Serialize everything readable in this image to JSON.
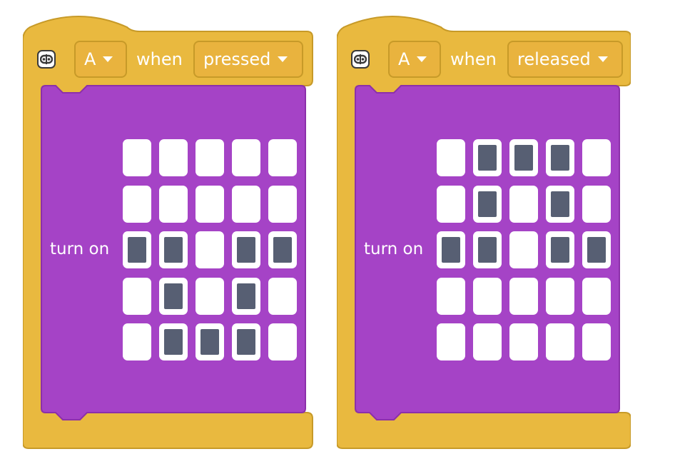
{
  "blocks": [
    {
      "button": "A",
      "when_label": "when",
      "event": "pressed",
      "action_label": "turn on",
      "leds": [
        [
          0,
          0,
          0,
          0,
          0
        ],
        [
          0,
          0,
          0,
          0,
          0
        ],
        [
          1,
          1,
          0,
          1,
          1
        ],
        [
          0,
          1,
          0,
          1,
          0
        ],
        [
          0,
          1,
          1,
          1,
          0
        ]
      ]
    },
    {
      "button": "A",
      "when_label": "when",
      "event": "released",
      "action_label": "turn on",
      "leds": [
        [
          0,
          1,
          1,
          1,
          0
        ],
        [
          0,
          1,
          0,
          1,
          0
        ],
        [
          1,
          1,
          0,
          1,
          1
        ],
        [
          0,
          0,
          0,
          0,
          0
        ],
        [
          0,
          0,
          0,
          0,
          0
        ]
      ]
    }
  ],
  "colors": {
    "hat": "#e9b93f",
    "hat_border": "#c79a28",
    "body": "#a543c6",
    "body_border": "#8c30aa",
    "led_on": "#575f73",
    "led_off": "#ffffff"
  },
  "icons": {
    "microbit": "microbit-icon",
    "dropdown": "chevron-down-icon"
  }
}
